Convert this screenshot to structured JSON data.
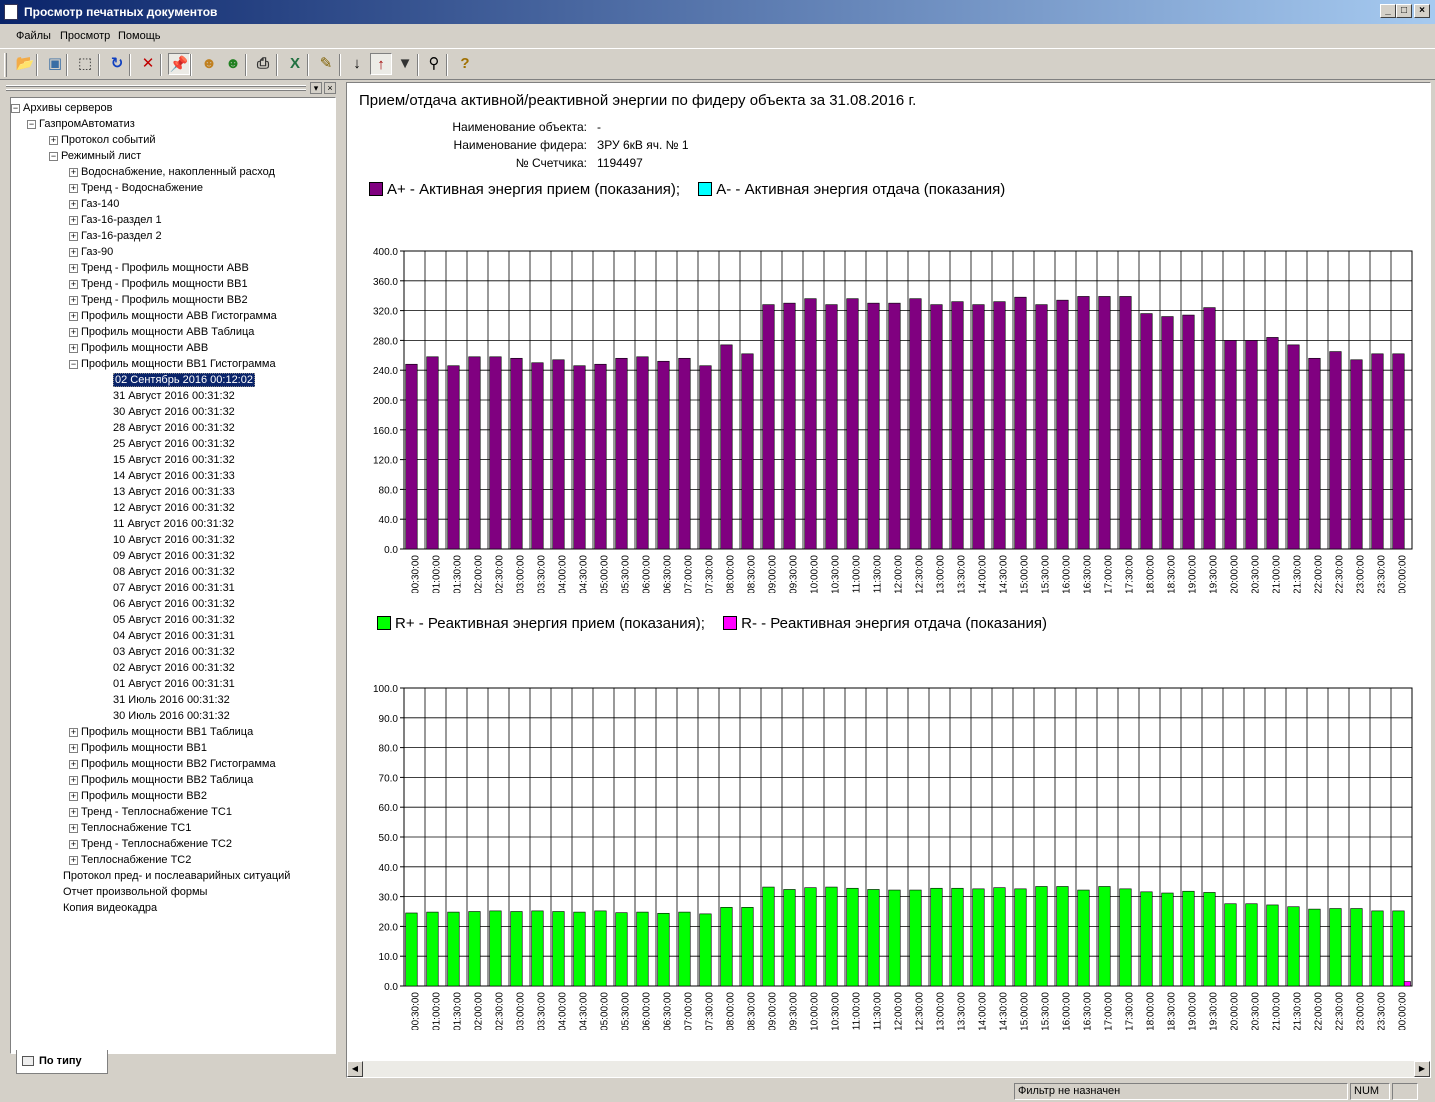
{
  "window": {
    "title": "Просмотр печатных документов"
  },
  "menu": [
    "Файлы",
    "Просмотр",
    "Помощь"
  ],
  "toolbar": [
    {
      "name": "open-folder-icon",
      "glyph": "📂",
      "color": "#c89a20"
    },
    {
      "name": "page-preview-icon",
      "glyph": "▣",
      "color": "#3a6ea5"
    },
    {
      "name": "select-area-icon",
      "glyph": "⬚",
      "color": "#333333"
    },
    {
      "name": "refresh-icon",
      "glyph": "↻",
      "color": "#1040c0"
    },
    {
      "name": "delete-icon",
      "glyph": "✕",
      "color": "#c00000"
    },
    {
      "name": "pin-icon",
      "glyph": "📌",
      "color": "#1040c0",
      "pressed": true
    },
    {
      "name": "user-connect-icon",
      "glyph": "☻",
      "color": "#c08020"
    },
    {
      "name": "user-disconnect-icon",
      "glyph": "☻",
      "color": "#208020"
    },
    {
      "name": "print-icon",
      "glyph": "⎙",
      "color": "#333333"
    },
    {
      "name": "excel-export-icon",
      "glyph": "X",
      "color": "#207040"
    },
    {
      "name": "properties-icon",
      "glyph": "✎",
      "color": "#806000"
    },
    {
      "name": "sort-asc-icon",
      "glyph": "↓",
      "color": "#000000"
    },
    {
      "name": "sort-desc-icon",
      "glyph": "↑",
      "color": "#a00000",
      "pressed": true
    },
    {
      "name": "filter-icon",
      "glyph": "▼",
      "color": "#333333"
    },
    {
      "name": "search-icon",
      "glyph": "⚲",
      "color": "#000000"
    },
    {
      "name": "help-icon",
      "glyph": "?",
      "color": "#a07000"
    }
  ],
  "tree": [
    {
      "level": 0,
      "toggle": "−",
      "label": "Архивы серверов"
    },
    {
      "level": 1,
      "toggle": "−",
      "label": "ГазпромАвтоматиз"
    },
    {
      "level": 2,
      "toggle": "+",
      "label": "Протокол событий"
    },
    {
      "level": 2,
      "toggle": "−",
      "label": "Режимный лист"
    },
    {
      "level": 3,
      "toggle": "+",
      "label": "Водоснабжение, накопленный расход"
    },
    {
      "level": 3,
      "toggle": "+",
      "label": "Тренд - Водоснабжение"
    },
    {
      "level": 3,
      "toggle": "+",
      "label": "Газ-140"
    },
    {
      "level": 3,
      "toggle": "+",
      "label": "Газ-16-раздел 1"
    },
    {
      "level": 3,
      "toggle": "+",
      "label": "Газ-16-раздел 2"
    },
    {
      "level": 3,
      "toggle": "+",
      "label": "Газ-90"
    },
    {
      "level": 3,
      "toggle": "+",
      "label": "Тренд - Профиль мощности АВВ"
    },
    {
      "level": 3,
      "toggle": "+",
      "label": "Тренд - Профиль мощности ВВ1"
    },
    {
      "level": 3,
      "toggle": "+",
      "label": "Тренд - Профиль мощности ВВ2"
    },
    {
      "level": 3,
      "toggle": "+",
      "label": "Профиль мощности АВВ Гистограмма"
    },
    {
      "level": 3,
      "toggle": "+",
      "label": "Профиль мощности АВВ Таблица"
    },
    {
      "level": 3,
      "toggle": "+",
      "label": "Профиль мощности АВВ"
    },
    {
      "level": 3,
      "toggle": "−",
      "label": "Профиль мощности ВВ1 Гистограмма"
    },
    {
      "level": 4,
      "toggle": "",
      "label": "02 Сентябрь 2016 00:12:02",
      "selected": true
    },
    {
      "level": 4,
      "toggle": "",
      "label": "31 Август 2016 00:31:32"
    },
    {
      "level": 4,
      "toggle": "",
      "label": "30 Август 2016 00:31:32"
    },
    {
      "level": 4,
      "toggle": "",
      "label": "28 Август 2016 00:31:32"
    },
    {
      "level": 4,
      "toggle": "",
      "label": "25 Август 2016 00:31:32"
    },
    {
      "level": 4,
      "toggle": "",
      "label": "15 Август 2016 00:31:32"
    },
    {
      "level": 4,
      "toggle": "",
      "label": "14 Август 2016 00:31:33"
    },
    {
      "level": 4,
      "toggle": "",
      "label": "13 Август 2016 00:31:33"
    },
    {
      "level": 4,
      "toggle": "",
      "label": "12 Август 2016 00:31:32"
    },
    {
      "level": 4,
      "toggle": "",
      "label": "11 Август 2016 00:31:32"
    },
    {
      "level": 4,
      "toggle": "",
      "label": "10 Август 2016 00:31:32"
    },
    {
      "level": 4,
      "toggle": "",
      "label": "09 Август 2016 00:31:32"
    },
    {
      "level": 4,
      "toggle": "",
      "label": "08 Август 2016 00:31:32"
    },
    {
      "level": 4,
      "toggle": "",
      "label": "07 Август 2016 00:31:31"
    },
    {
      "level": 4,
      "toggle": "",
      "label": "06 Август 2016 00:31:32"
    },
    {
      "level": 4,
      "toggle": "",
      "label": "05 Август 2016 00:31:32"
    },
    {
      "level": 4,
      "toggle": "",
      "label": "04 Август 2016 00:31:31"
    },
    {
      "level": 4,
      "toggle": "",
      "label": "03 Август 2016 00:31:32"
    },
    {
      "level": 4,
      "toggle": "",
      "label": "02 Август 2016 00:31:32"
    },
    {
      "level": 4,
      "toggle": "",
      "label": "01 Август 2016 00:31:31"
    },
    {
      "level": 4,
      "toggle": "",
      "label": "31 Июль 2016 00:31:32"
    },
    {
      "level": 4,
      "toggle": "",
      "label": "30 Июль 2016 00:31:32"
    },
    {
      "level": 3,
      "toggle": "+",
      "label": "Профиль мощности ВВ1 Таблица"
    },
    {
      "level": 3,
      "toggle": "+",
      "label": "Профиль мощности ВВ1"
    },
    {
      "level": 3,
      "toggle": "+",
      "label": "Профиль мощности ВВ2 Гистограмма"
    },
    {
      "level": 3,
      "toggle": "+",
      "label": "Профиль мощности ВВ2 Таблица"
    },
    {
      "level": 3,
      "toggle": "+",
      "label": "Профиль мощности ВВ2"
    },
    {
      "level": 3,
      "toggle": "+",
      "label": "Тренд - Теплоснабжение ТС1"
    },
    {
      "level": 3,
      "toggle": "+",
      "label": "Теплоснабжение ТС1"
    },
    {
      "level": 3,
      "toggle": "+",
      "label": "Тренд - Теплоснабжение ТС2"
    },
    {
      "level": 3,
      "toggle": "+",
      "label": "Теплоснабжение ТС2"
    },
    {
      "level": 2,
      "toggle": "",
      "label": "Протокол пред- и послеаварийных ситуаций"
    },
    {
      "level": 2,
      "toggle": "",
      "label": "Отчет произвольной формы"
    },
    {
      "level": 2,
      "toggle": "",
      "label": "Копия видеокадра"
    }
  ],
  "tab": {
    "label": "По типу"
  },
  "report": {
    "title": "Прием/отдача активной/реактивной энергии  по фидеру объекта за 31.08.2016  г.",
    "info": [
      {
        "label": "Наименование объекта:",
        "value": "-"
      },
      {
        "label": "Наименование фидера:",
        "value": "ЗРУ 6кВ яч. № 1"
      },
      {
        "label": "№ Счетчика:",
        "value": "1194497"
      }
    ]
  },
  "legends": {
    "active": [
      {
        "text": "A+  -  Активная энергия прием (показания);",
        "color": "#800080"
      },
      {
        "text": "A-  -  Активная энергия отдача (показания)",
        "color": "#00ffff"
      }
    ],
    "reactive": [
      {
        "text": "R+  -  Реактивная энергия прием (показания);",
        "color": "#00ff00"
      },
      {
        "text": "R-  -  Реактивная энергия отдача (показания)",
        "color": "#ff00ff"
      }
    ]
  },
  "chart_data": [
    {
      "type": "bar",
      "categories": [
        "00:30:00",
        "01:00:00",
        "01:30:00",
        "02:00:00",
        "02:30:00",
        "03:00:00",
        "03:30:00",
        "04:00:00",
        "04:30:00",
        "05:00:00",
        "05:30:00",
        "06:00:00",
        "06:30:00",
        "07:00:00",
        "07:30:00",
        "08:00:00",
        "08:30:00",
        "09:00:00",
        "09:30:00",
        "10:00:00",
        "10:30:00",
        "11:00:00",
        "11:30:00",
        "12:00:00",
        "12:30:00",
        "13:00:00",
        "13:30:00",
        "14:00:00",
        "14:30:00",
        "15:00:00",
        "15:30:00",
        "16:00:00",
        "16:30:00",
        "17:00:00",
        "17:30:00",
        "18:00:00",
        "18:30:00",
        "19:00:00",
        "19:30:00",
        "20:00:00",
        "20:30:00",
        "21:00:00",
        "21:30:00",
        "22:00:00",
        "22:30:00",
        "23:00:00",
        "23:30:00",
        "00:00:00"
      ],
      "series": [
        {
          "name": "A+",
          "color": "#800080",
          "values": [
            248,
            258,
            246,
            258,
            258,
            256,
            250,
            254,
            246,
            248,
            256,
            258,
            252,
            256,
            246,
            274,
            262,
            328,
            330,
            336,
            328,
            336,
            330,
            330,
            336,
            328,
            332,
            328,
            332,
            338,
            328,
            334,
            339,
            339,
            339,
            316,
            312,
            314,
            324,
            280,
            280,
            284,
            274,
            256,
            265,
            254,
            262,
            262
          ]
        },
        {
          "name": "A-",
          "color": "#00ffff",
          "values": [
            0,
            0,
            0,
            0,
            0,
            0,
            0,
            0,
            0,
            0,
            0,
            0,
            0,
            0,
            0,
            0,
            0,
            0,
            0,
            0,
            0,
            0,
            0,
            0,
            0,
            0,
            0,
            0,
            0,
            0,
            0,
            0,
            0,
            0,
            0,
            0,
            0,
            0,
            0,
            0,
            0,
            0,
            0,
            0,
            0,
            0,
            0,
            0
          ]
        }
      ],
      "ylim": [
        0,
        400
      ],
      "yticks": [
        "0.0",
        "40.0",
        "80.0",
        "120.0",
        "160.0",
        "200.0",
        "240.0",
        "280.0",
        "320.0",
        "360.0",
        "400.0"
      ],
      "grid": true
    },
    {
      "type": "bar",
      "categories": [
        "00:30:00",
        "01:00:00",
        "01:30:00",
        "02:00:00",
        "02:30:00",
        "03:00:00",
        "03:30:00",
        "04:00:00",
        "04:30:00",
        "05:00:00",
        "05:30:00",
        "06:00:00",
        "06:30:00",
        "07:00:00",
        "07:30:00",
        "08:00:00",
        "08:30:00",
        "09:00:00",
        "09:30:00",
        "10:00:00",
        "10:30:00",
        "11:00:00",
        "11:30:00",
        "12:00:00",
        "12:30:00",
        "13:00:00",
        "13:30:00",
        "14:00:00",
        "14:30:00",
        "15:00:00",
        "15:30:00",
        "16:00:00",
        "16:30:00",
        "17:00:00",
        "17:30:00",
        "18:00:00",
        "18:30:00",
        "19:00:00",
        "19:30:00",
        "20:00:00",
        "20:30:00",
        "21:00:00",
        "21:30:00",
        "22:00:00",
        "22:30:00",
        "23:00:00",
        "23:30:00",
        "00:00:00"
      ],
      "series": [
        {
          "name": "R+",
          "color": "#00ff00",
          "values": [
            24.5,
            24.8,
            24.8,
            25.0,
            25.2,
            25.0,
            25.2,
            25.0,
            24.8,
            25.2,
            24.6,
            24.8,
            24.4,
            24.8,
            24.2,
            26.4,
            26.4,
            33.2,
            32.4,
            33.0,
            33.2,
            32.8,
            32.4,
            32.2,
            32.2,
            32.8,
            32.8,
            32.6,
            33.0,
            32.6,
            33.4,
            33.4,
            32.2,
            33.4,
            32.6,
            31.6,
            31.2,
            31.8,
            31.4,
            27.6,
            27.6,
            27.2,
            26.6,
            25.8,
            26.0,
            26.0,
            25.2,
            25.2
          ]
        },
        {
          "name": "R-",
          "color": "#ff00ff",
          "values": [
            0,
            0,
            0,
            0,
            0,
            0,
            0,
            0,
            0,
            0,
            0,
            0,
            0,
            0,
            0,
            0,
            0,
            0,
            0,
            0,
            0,
            0,
            0,
            0,
            0,
            0,
            0,
            0,
            0,
            0,
            0,
            0,
            0,
            0,
            0,
            0,
            0,
            0,
            0,
            0,
            0,
            0,
            0,
            0,
            0,
            0,
            0,
            1.5
          ]
        }
      ],
      "ylim": [
        0,
        100
      ],
      "yticks": [
        "0.0",
        "10.0",
        "20.0",
        "30.0",
        "40.0",
        "50.0",
        "60.0",
        "70.0",
        "80.0",
        "90.0",
        "100.0"
      ],
      "grid": true
    }
  ],
  "status": {
    "filter": "Фильтр не назначен",
    "num": "NUM"
  }
}
